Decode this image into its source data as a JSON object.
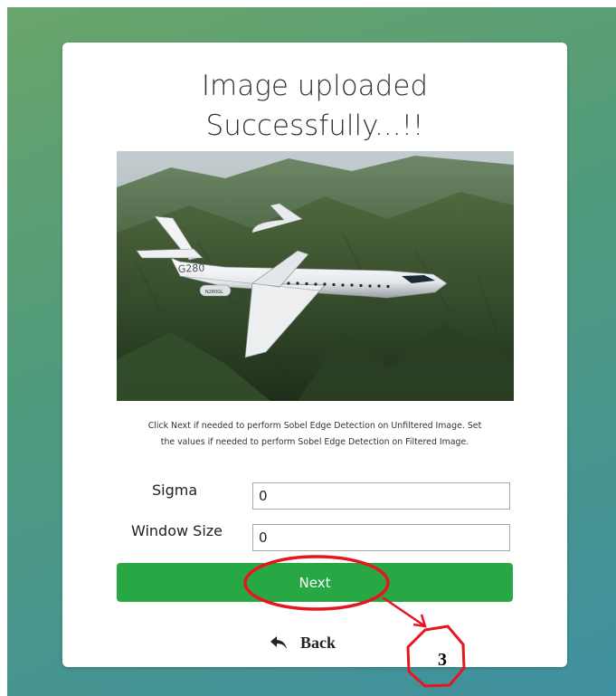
{
  "card": {
    "title_line1": "Image uploaded",
    "title_line2": "Successfully...!!",
    "description_line1": "Click Next if needed to perform Sobel Edge Detection on Unfiltered Image. Set",
    "description_line2": "the values if needed to perform Sobel Edge Detection on Filtered Image."
  },
  "photo": {
    "tail_text": "G280",
    "registration": "N280GL"
  },
  "form": {
    "sigma_label": "Sigma",
    "sigma_value": "0",
    "window_label": "Window Size",
    "window_value": "0"
  },
  "actions": {
    "next_label": "Next",
    "back_label": "Back",
    "back_icon": "reply-arrow-icon"
  },
  "annotation": {
    "step_number": "3",
    "color": "#e8141e"
  },
  "colors": {
    "primary_button": "#28a745",
    "card_background": "#ffffff"
  }
}
